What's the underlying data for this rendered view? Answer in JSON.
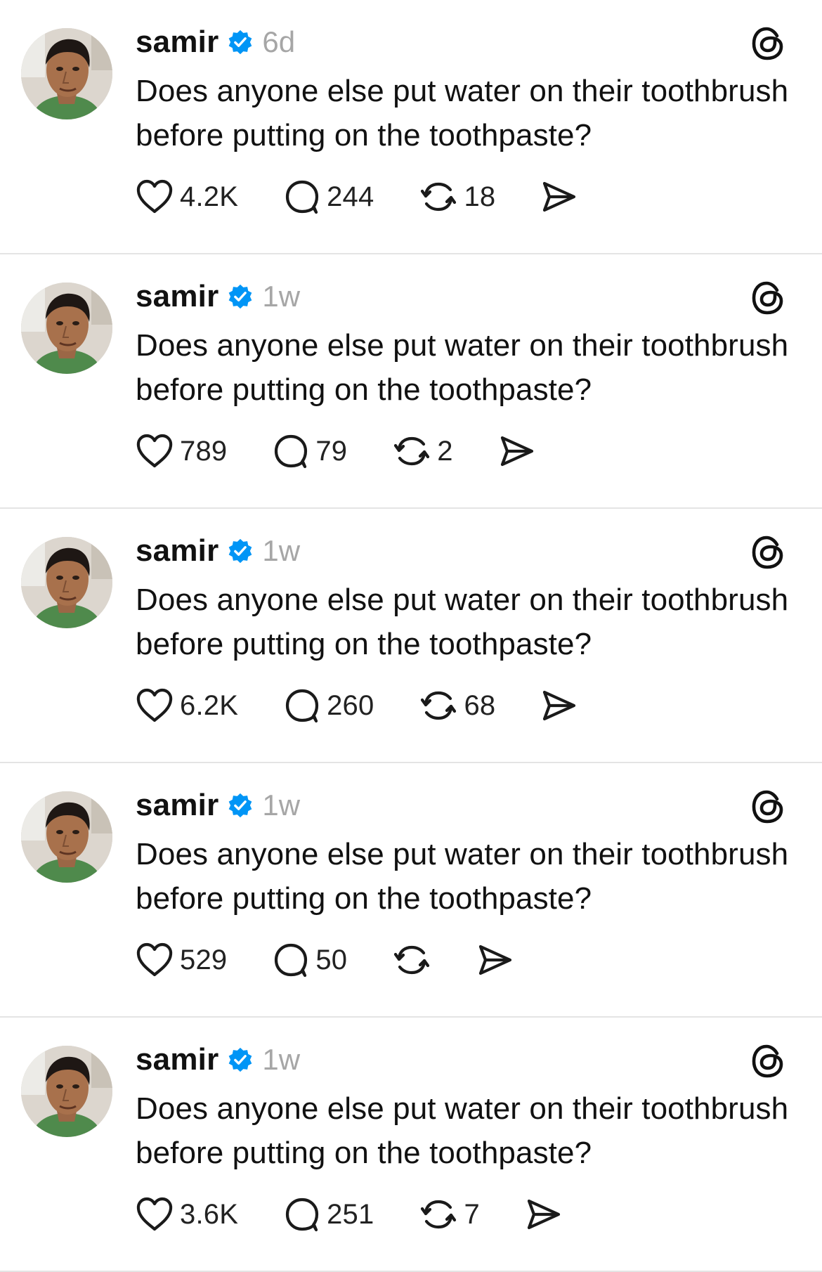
{
  "posts": [
    {
      "username": "samir",
      "time": "6d",
      "text": "Does anyone else put water on their toothbrush before putting on the toothpaste?",
      "likes": "4.2K",
      "replies": "244",
      "reposts": "18"
    },
    {
      "username": "samir",
      "time": "1w",
      "text": "Does anyone else put water on their toothbrush before putting on the toothpaste?",
      "likes": "789",
      "replies": "79",
      "reposts": "2"
    },
    {
      "username": "samir",
      "time": "1w",
      "text": "Does anyone else put water on their toothbrush before putting on the toothpaste?",
      "likes": "6.2K",
      "replies": "260",
      "reposts": "68"
    },
    {
      "username": "samir",
      "time": "1w",
      "text": "Does anyone else put water on their toothbrush before putting on the toothpaste?",
      "likes": "529",
      "replies": "50",
      "reposts": ""
    },
    {
      "username": "samir",
      "time": "1w",
      "text": "Does anyone else put water on their toothbrush before putting on the toothpaste?",
      "likes": "3.6K",
      "replies": "251",
      "reposts": "7"
    }
  ],
  "icons": {
    "verified": "verified-badge-icon",
    "threads": "threads-logo-icon",
    "like": "heart-icon",
    "reply": "comment-bubble-icon",
    "repost": "repost-icon",
    "share": "send-icon"
  },
  "colors": {
    "verified_blue": "#0095f6",
    "timestamp_gray": "#a6a6a6",
    "divider": "#e4e4e4"
  }
}
